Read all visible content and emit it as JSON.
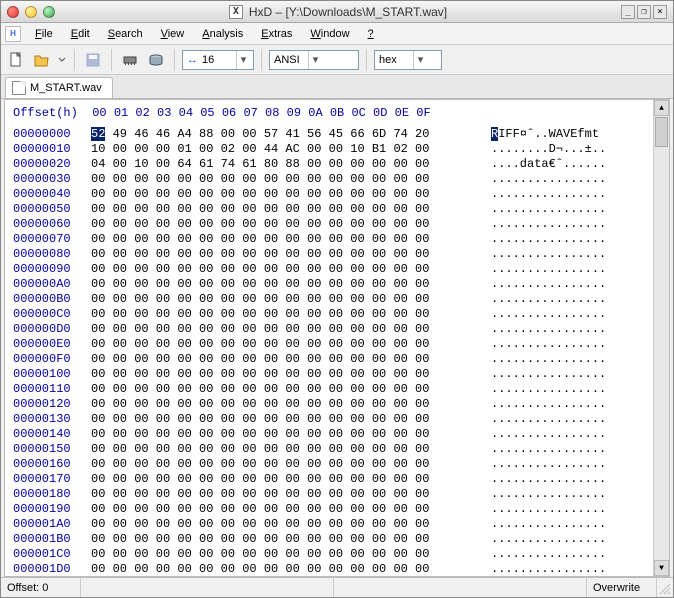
{
  "title": "HxD – [Y:\\Downloads\\M_START.wav]",
  "menu": {
    "file": "File",
    "edit": "Edit",
    "search": "Search",
    "view": "View",
    "analysis": "Analysis",
    "extras": "Extras",
    "window": "Window",
    "help": "?"
  },
  "toolbar": {
    "bytewidth_prefix": "↔",
    "bytewidth": "16",
    "charset": "ANSI",
    "base": "hex"
  },
  "tab": {
    "label": "M_START.wav"
  },
  "hex": {
    "header": "Offset(h)  00 01 02 03 04 05 06 07 08 09 0A 0B 0C 0D 0E 0F",
    "rows": [
      {
        "off": "00000000",
        "hex": "52 49 46 46 A4 88 00 00 57 41 56 45 66 6D 74 20",
        "asc": "RIFF¤ˆ..WAVEfmt "
      },
      {
        "off": "00000010",
        "hex": "10 00 00 00 01 00 02 00 44 AC 00 00 10 B1 02 00",
        "asc": "........D¬...±.."
      },
      {
        "off": "00000020",
        "hex": "04 00 10 00 64 61 74 61 80 88 00 00 00 00 00 00",
        "asc": "....data€ˆ......"
      },
      {
        "off": "00000030",
        "hex": "00 00 00 00 00 00 00 00 00 00 00 00 00 00 00 00",
        "asc": "................"
      },
      {
        "off": "00000040",
        "hex": "00 00 00 00 00 00 00 00 00 00 00 00 00 00 00 00",
        "asc": "................"
      },
      {
        "off": "00000050",
        "hex": "00 00 00 00 00 00 00 00 00 00 00 00 00 00 00 00",
        "asc": "................"
      },
      {
        "off": "00000060",
        "hex": "00 00 00 00 00 00 00 00 00 00 00 00 00 00 00 00",
        "asc": "................"
      },
      {
        "off": "00000070",
        "hex": "00 00 00 00 00 00 00 00 00 00 00 00 00 00 00 00",
        "asc": "................"
      },
      {
        "off": "00000080",
        "hex": "00 00 00 00 00 00 00 00 00 00 00 00 00 00 00 00",
        "asc": "................"
      },
      {
        "off": "00000090",
        "hex": "00 00 00 00 00 00 00 00 00 00 00 00 00 00 00 00",
        "asc": "................"
      },
      {
        "off": "000000A0",
        "hex": "00 00 00 00 00 00 00 00 00 00 00 00 00 00 00 00",
        "asc": "................"
      },
      {
        "off": "000000B0",
        "hex": "00 00 00 00 00 00 00 00 00 00 00 00 00 00 00 00",
        "asc": "................"
      },
      {
        "off": "000000C0",
        "hex": "00 00 00 00 00 00 00 00 00 00 00 00 00 00 00 00",
        "asc": "................"
      },
      {
        "off": "000000D0",
        "hex": "00 00 00 00 00 00 00 00 00 00 00 00 00 00 00 00",
        "asc": "................"
      },
      {
        "off": "000000E0",
        "hex": "00 00 00 00 00 00 00 00 00 00 00 00 00 00 00 00",
        "asc": "................"
      },
      {
        "off": "000000F0",
        "hex": "00 00 00 00 00 00 00 00 00 00 00 00 00 00 00 00",
        "asc": "................"
      },
      {
        "off": "00000100",
        "hex": "00 00 00 00 00 00 00 00 00 00 00 00 00 00 00 00",
        "asc": "................"
      },
      {
        "off": "00000110",
        "hex": "00 00 00 00 00 00 00 00 00 00 00 00 00 00 00 00",
        "asc": "................"
      },
      {
        "off": "00000120",
        "hex": "00 00 00 00 00 00 00 00 00 00 00 00 00 00 00 00",
        "asc": "................"
      },
      {
        "off": "00000130",
        "hex": "00 00 00 00 00 00 00 00 00 00 00 00 00 00 00 00",
        "asc": "................"
      },
      {
        "off": "00000140",
        "hex": "00 00 00 00 00 00 00 00 00 00 00 00 00 00 00 00",
        "asc": "................"
      },
      {
        "off": "00000150",
        "hex": "00 00 00 00 00 00 00 00 00 00 00 00 00 00 00 00",
        "asc": "................"
      },
      {
        "off": "00000160",
        "hex": "00 00 00 00 00 00 00 00 00 00 00 00 00 00 00 00",
        "asc": "................"
      },
      {
        "off": "00000170",
        "hex": "00 00 00 00 00 00 00 00 00 00 00 00 00 00 00 00",
        "asc": "................"
      },
      {
        "off": "00000180",
        "hex": "00 00 00 00 00 00 00 00 00 00 00 00 00 00 00 00",
        "asc": "................"
      },
      {
        "off": "00000190",
        "hex": "00 00 00 00 00 00 00 00 00 00 00 00 00 00 00 00",
        "asc": "................"
      },
      {
        "off": "000001A0",
        "hex": "00 00 00 00 00 00 00 00 00 00 00 00 00 00 00 00",
        "asc": "................"
      },
      {
        "off": "000001B0",
        "hex": "00 00 00 00 00 00 00 00 00 00 00 00 00 00 00 00",
        "asc": "................"
      },
      {
        "off": "000001C0",
        "hex": "00 00 00 00 00 00 00 00 00 00 00 00 00 00 00 00",
        "asc": "................"
      },
      {
        "off": "000001D0",
        "hex": "00 00 00 00 00 00 00 00 00 00 00 00 00 00 00 00",
        "asc": "................"
      }
    ]
  },
  "status": {
    "offset": "Offset: 0",
    "mode": "Overwrite"
  }
}
